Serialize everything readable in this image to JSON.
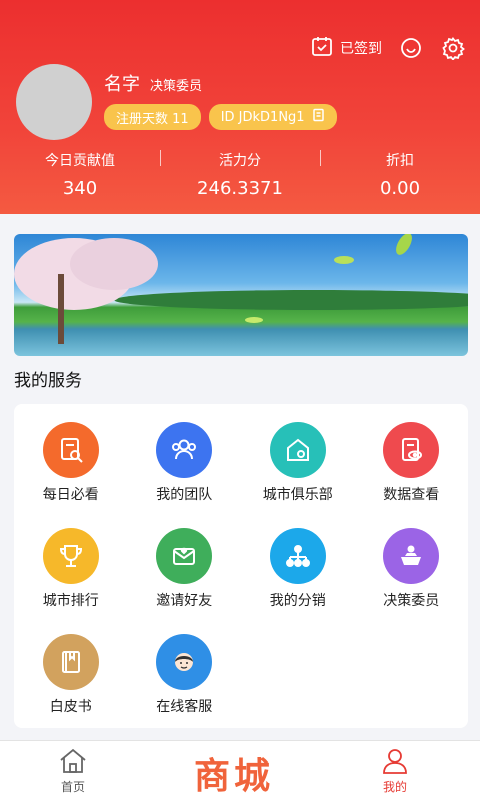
{
  "header": {
    "checkin_label": "已签到",
    "name": "名字",
    "role": "决策委员",
    "reg_days_label": "注册天数 11",
    "id_label": "ID JDkD1Ng1",
    "stats": [
      {
        "label": "今日贡献值",
        "value": "340"
      },
      {
        "label": "活力分",
        "value": "246.3371"
      },
      {
        "label": "折扣",
        "value": "0.00"
      }
    ]
  },
  "services_title": "我的服务",
  "services": [
    {
      "label": "每日必看",
      "icon": "magnify-doc-icon",
      "color": "#f46a2c"
    },
    {
      "label": "我的团队",
      "icon": "team-icon",
      "color": "#3d74f0"
    },
    {
      "label": "城市俱乐部",
      "icon": "location-house-icon",
      "color": "#27c0b8"
    },
    {
      "label": "数据查看",
      "icon": "doc-eye-icon",
      "color": "#ef4a4e"
    },
    {
      "label": "城市排行",
      "icon": "trophy-icon",
      "color": "#f6b82a"
    },
    {
      "label": "邀请好友",
      "icon": "envelope-heart-icon",
      "color": "#3fae5b"
    },
    {
      "label": "我的分销",
      "icon": "org-tree-icon",
      "color": "#1ca8ea"
    },
    {
      "label": "决策委员",
      "icon": "committee-icon",
      "color": "#9b64e6"
    },
    {
      "label": "白皮书",
      "icon": "book-icon",
      "color": "#d2a25e"
    },
    {
      "label": "在线客服",
      "icon": "service-agent-icon",
      "color": "#2f8fe6"
    }
  ],
  "nav": {
    "home_label": "首页",
    "mall_label": "商城",
    "mine_label": "我的"
  },
  "colors": {
    "header_red": "#ec2f2f",
    "badge_yellow": "#f9c44c",
    "active_red": "#e63b34"
  }
}
